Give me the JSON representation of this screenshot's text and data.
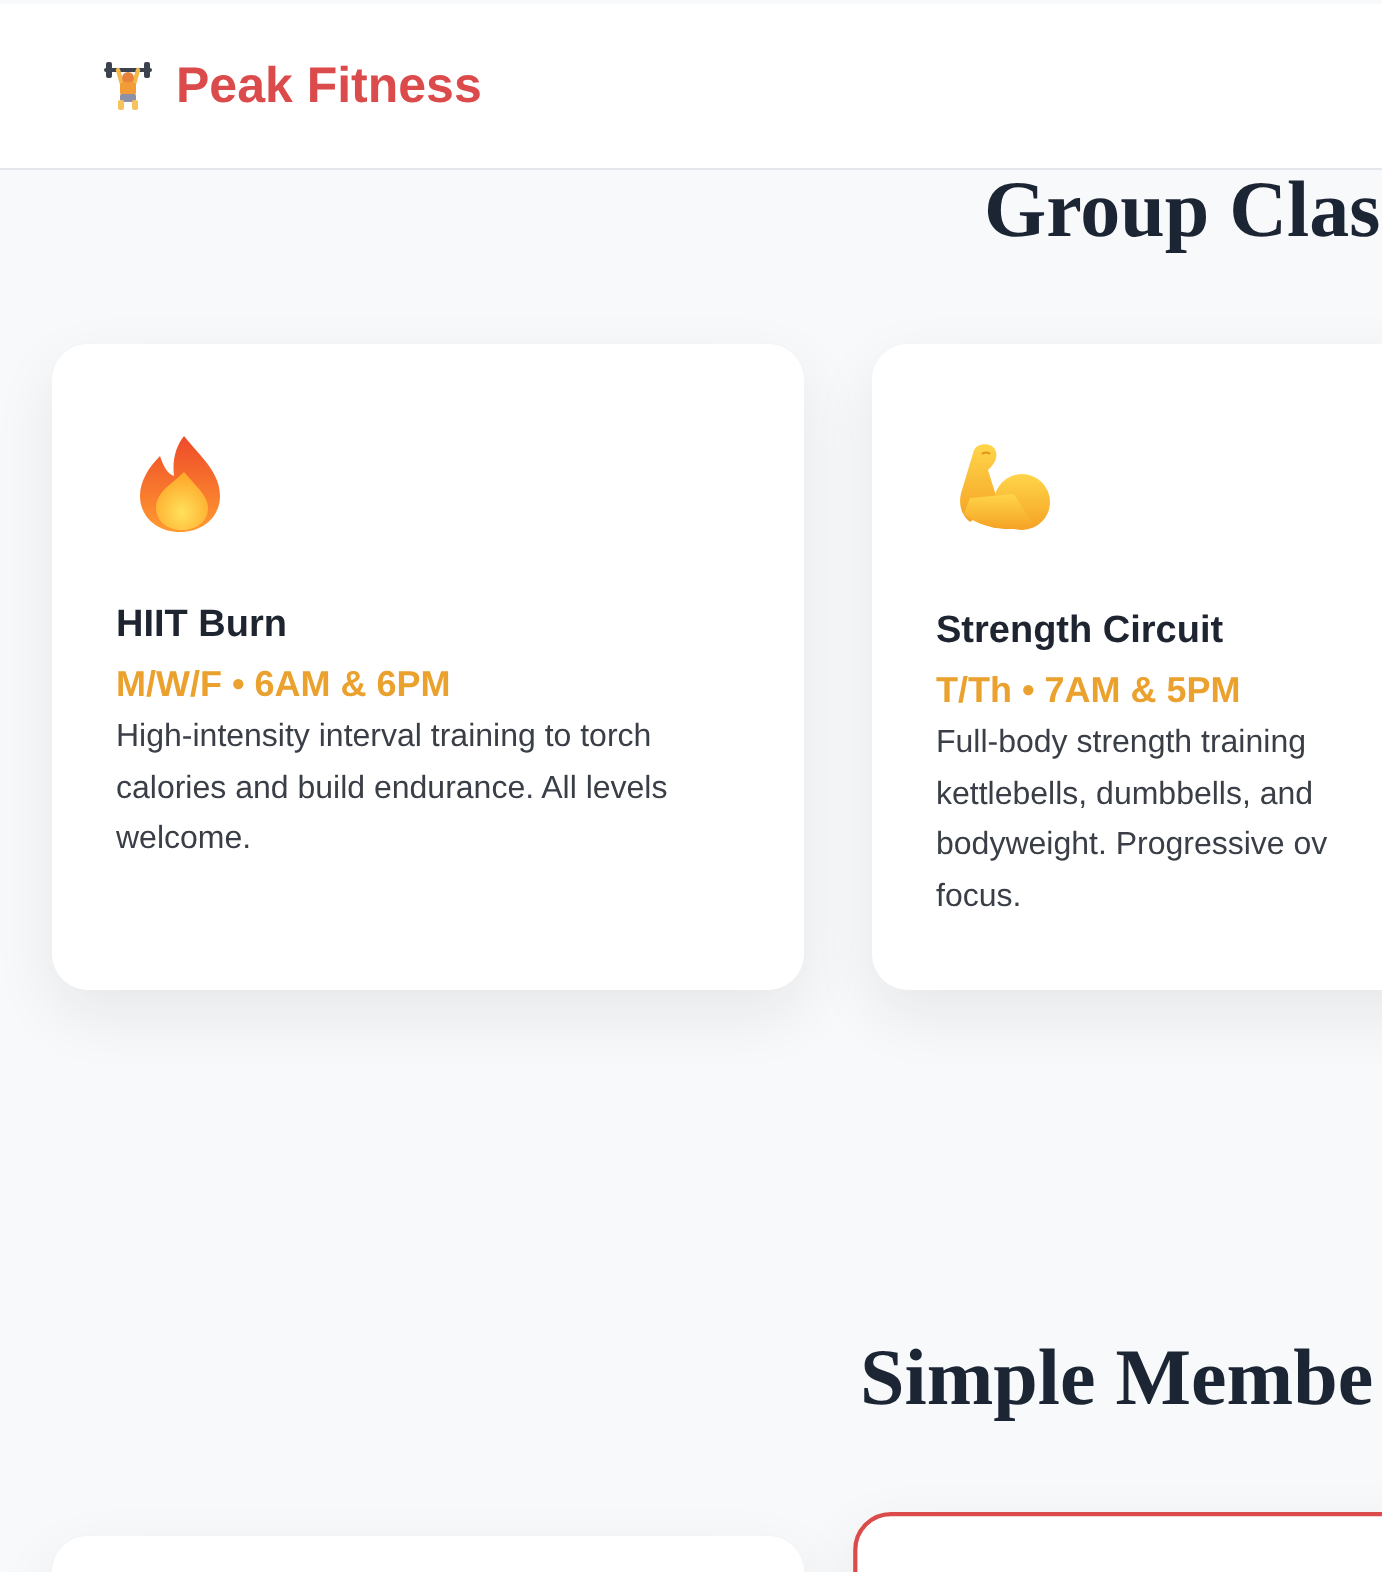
{
  "header": {
    "logo_text": "Peak Fitness"
  },
  "classes": {
    "title": "Group Clas",
    "cards": [
      {
        "name": "HIIT Burn",
        "schedule": "M/W/F • 6AM & 6PM",
        "description_lines": [
          "High-intensity interval training to torch",
          "calories and build endurance. All levels",
          "welcome."
        ]
      },
      {
        "name": "Strength Circuit",
        "schedule": "T/Th • 7AM & 5PM",
        "description_lines": [
          "Full-body strength training",
          "kettlebells, dumbbells, and",
          "bodyweight. Progressive ov",
          "focus."
        ]
      }
    ]
  },
  "membership": {
    "title": "Simple Membe",
    "plans": [
      {
        "featured": false
      },
      {
        "featured": true
      }
    ]
  }
}
